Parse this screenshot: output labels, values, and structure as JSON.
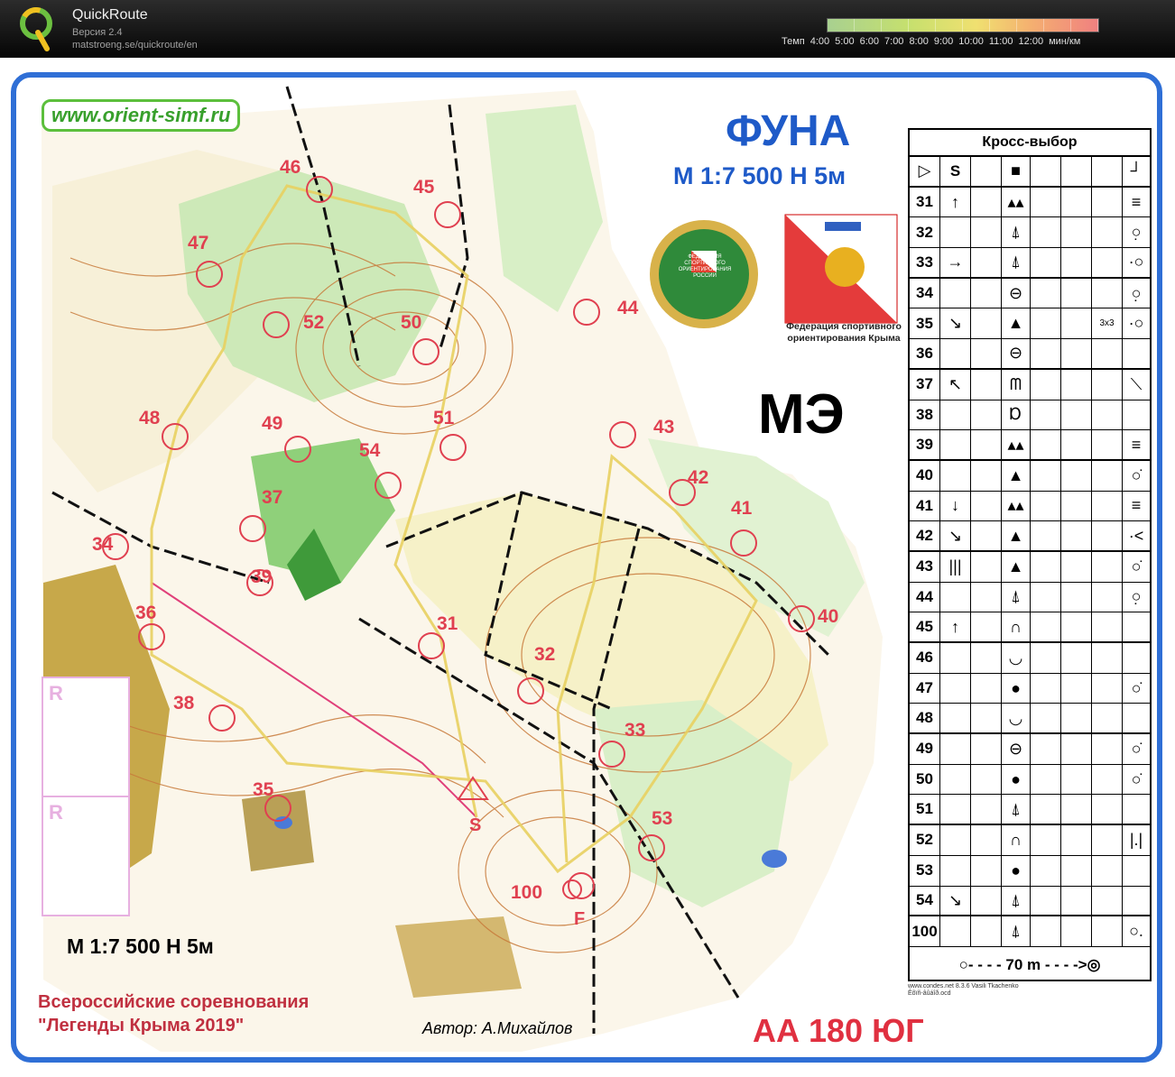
{
  "app": {
    "name": "QuickRoute",
    "version": "Версия 2.4",
    "url": "matstroeng.se/quickroute/en",
    "logo_icon": "quickroute-q-logo-icon"
  },
  "pace_legend": {
    "label": "Темп",
    "ticks": [
      "4:00",
      "5:00",
      "6:00",
      "7:00",
      "8:00",
      "9:00",
      "10:00",
      "11:00",
      "12:00"
    ],
    "unit": "мин/км",
    "colors": {
      "fast": "#a8d090",
      "medium": "#f0e070",
      "slow": "#f08080"
    }
  },
  "map": {
    "website": "www.orient-simf.ru",
    "title": "ФУНА",
    "scale_top": "М 1:7 500    Н 5м",
    "class": "МЭ",
    "scale_bottom": "М 1:7 500    Н 5м",
    "event_line1": "Всероссийские соревнования",
    "event_line2": "\"Легенды Крыма 2019\"",
    "author": "Автор: А.Михайлов",
    "area": "АА 180    ЮГ",
    "federation_line1": "Федерация спортивного",
    "federation_line2": "ориентирования Крыма",
    "emblem_text": "ФЕДЕРАЦИЯ СПОРТИВНОГО ОРИЕНТИРОВАНИЯ РОССИИ",
    "r_box_label": "R",
    "start_label": "S",
    "finish_label": "F",
    "controls": [
      "31",
      "32",
      "33",
      "34",
      "35",
      "36",
      "37",
      "38",
      "39",
      "40",
      "41",
      "42",
      "43",
      "44",
      "45",
      "46",
      "47",
      "48",
      "49",
      "50",
      "51",
      "52",
      "53",
      "54",
      "100"
    ],
    "colors": {
      "frame": "#2f6fd6",
      "control": "#e04050",
      "green": "#6cc060",
      "contour": "#c87a3a",
      "route": "#e8d060"
    }
  },
  "control_descriptions": {
    "title": "Кросс-выбор",
    "start_row": [
      "▷",
      "S",
      "",
      "■",
      "",
      "",
      "",
      "┘"
    ],
    "rows": [
      [
        "31",
        "↑",
        "",
        "▴▴",
        "",
        "",
        "",
        "≡"
      ],
      [
        "32",
        "",
        "",
        "⍋",
        "",
        "",
        "",
        "○̣"
      ],
      [
        "33",
        "→",
        "",
        "⍋",
        "",
        "",
        "",
        "·○"
      ],
      [
        "34",
        "",
        "",
        "⊖",
        "",
        "",
        "",
        "○̣"
      ],
      [
        "35",
        "↘",
        "",
        "▲",
        "",
        "",
        "3x3",
        "·○"
      ],
      [
        "36",
        "",
        "",
        "⊖",
        "",
        "",
        "",
        ""
      ],
      [
        "37",
        "↖",
        "",
        "ᗰ",
        "",
        "",
        "",
        "⟍"
      ],
      [
        "38",
        "",
        "",
        "Ɒ",
        "",
        "",
        "",
        ""
      ],
      [
        "39",
        "",
        "",
        "▴▴",
        "",
        "",
        "",
        "≡"
      ],
      [
        "40",
        "",
        "",
        "▲",
        "",
        "",
        "",
        "○̇"
      ],
      [
        "41",
        "↓",
        "",
        "▴▴",
        "",
        "",
        "",
        "≡"
      ],
      [
        "42",
        "↘",
        "",
        "▲",
        "",
        "",
        "",
        "·<"
      ],
      [
        "43",
        "|||",
        "",
        "▲",
        "",
        "",
        "",
        "○̇"
      ],
      [
        "44",
        "",
        "",
        "⍋",
        "",
        "",
        "",
        "○̣"
      ],
      [
        "45",
        "↑",
        "",
        "∩",
        "",
        "",
        "",
        ""
      ],
      [
        "46",
        "",
        "",
        "◡",
        "",
        "",
        "",
        ""
      ],
      [
        "47",
        "",
        "",
        "●",
        "",
        "",
        "",
        "○̇"
      ],
      [
        "48",
        "",
        "",
        "◡",
        "",
        "",
        "",
        ""
      ],
      [
        "49",
        "",
        "",
        "⊖",
        "",
        "",
        "",
        "○̇"
      ],
      [
        "50",
        "",
        "",
        "●",
        "",
        "",
        "",
        "○̇"
      ],
      [
        "51",
        "",
        "",
        "⍋",
        "",
        "",
        "",
        ""
      ],
      [
        "52",
        "",
        "",
        "∩",
        "",
        "",
        "",
        "|.|"
      ],
      [
        "53",
        "",
        "",
        "●",
        "",
        "",
        "",
        ""
      ],
      [
        "54",
        "↘",
        "",
        "⍋",
        "",
        "",
        "",
        ""
      ],
      [
        "100",
        "",
        "",
        "⍋",
        "",
        "",
        "",
        "○."
      ]
    ],
    "footer": "○- - - -  70 m  - - - ->◎",
    "note_line1": "www.condes.net 8.3.6 Vasili Tkachenko",
    "note_line2": "Êõïñ-âûáîð.ocd"
  }
}
